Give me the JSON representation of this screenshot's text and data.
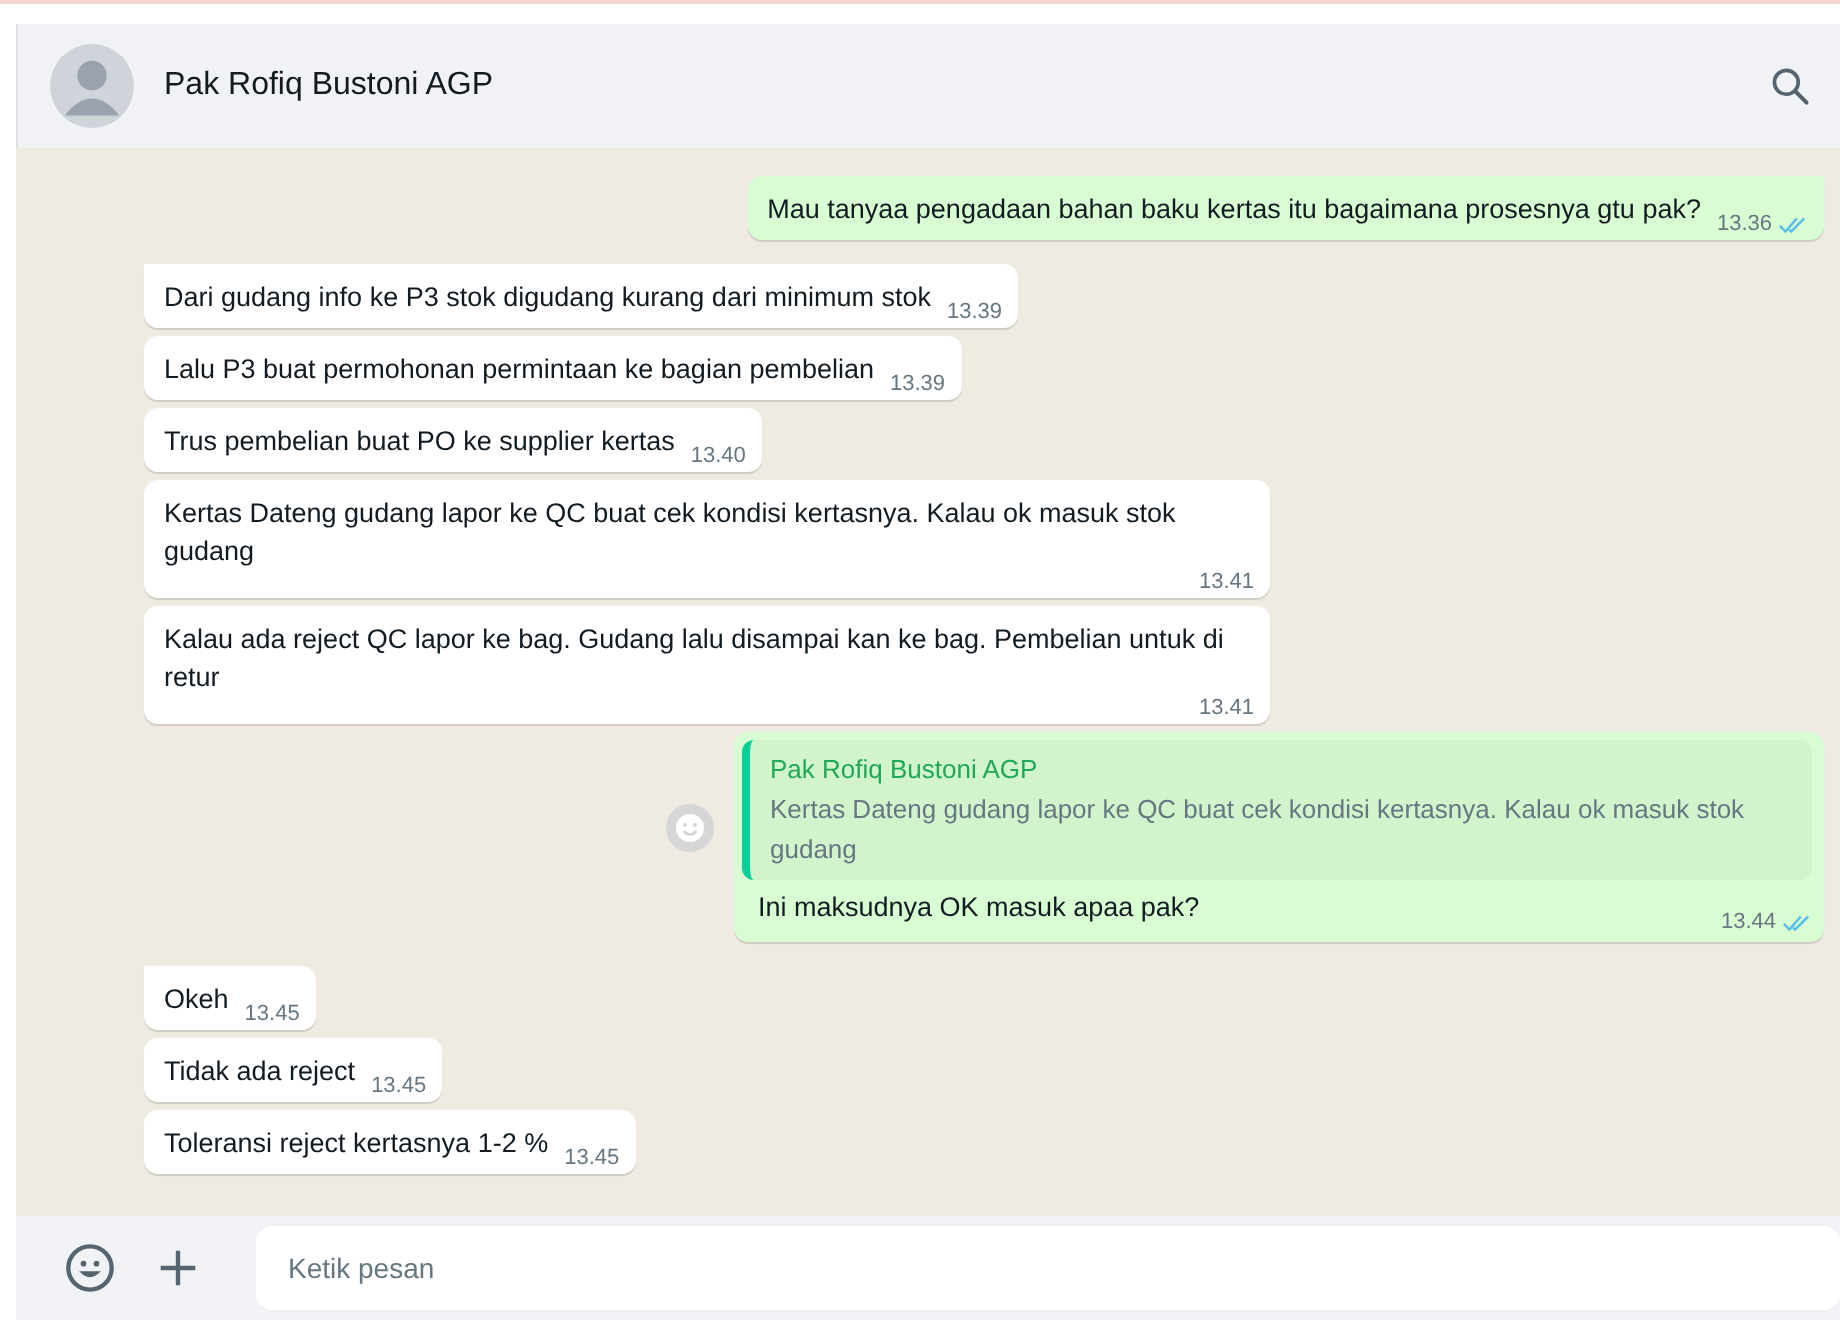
{
  "header": {
    "contact_name": "Pak Rofiq Bustoni AGP"
  },
  "messages": [
    {
      "kind": "outgoing",
      "tail": true,
      "text": "Mau tanyaa pengadaan bahan baku kertas itu bagaimana prosesnya gtu pak?",
      "time": "13.36",
      "read": true
    },
    {
      "kind": "incoming",
      "tail": true,
      "text": "Dari gudang info ke P3 stok digudang kurang dari minimum stok",
      "time": "13.39"
    },
    {
      "kind": "incoming",
      "tail": false,
      "text": "Lalu P3 buat permohonan permintaan ke bagian pembelian",
      "time": "13.39"
    },
    {
      "kind": "incoming",
      "tail": false,
      "text": "Trus pembelian buat PO ke supplier kertas",
      "time": "13.40"
    },
    {
      "kind": "incoming",
      "tail": false,
      "text": "Kertas Dateng gudang lapor ke QC buat cek kondisi kertasnya. Kalau ok masuk stok gudang",
      "time": "13.41"
    },
    {
      "kind": "incoming",
      "tail": false,
      "text": "Kalau ada reject QC lapor ke bag. Gudang lalu disampai kan ke bag. Pembelian untuk di retur",
      "time": "13.41"
    },
    {
      "kind": "outgoing",
      "tail": false,
      "quote": {
        "author": "Pak Rofiq Bustoni AGP",
        "text": "Kertas Dateng gudang lapor ke QC buat cek kondisi kertasnya. Kalau ok masuk stok gudang"
      },
      "text": "Ini maksudnya OK masuk apaa pak?",
      "time": "13.44",
      "read": true
    },
    {
      "kind": "incoming",
      "tail": true,
      "text": "Okeh",
      "time": "13.45"
    },
    {
      "kind": "incoming",
      "tail": false,
      "text": "Tidak ada reject",
      "time": "13.45"
    },
    {
      "kind": "incoming",
      "tail": false,
      "text": "Toleransi reject kertasnya 1-2 %",
      "time": "13.45"
    }
  ],
  "composer": {
    "placeholder": "Ketik pesan"
  }
}
